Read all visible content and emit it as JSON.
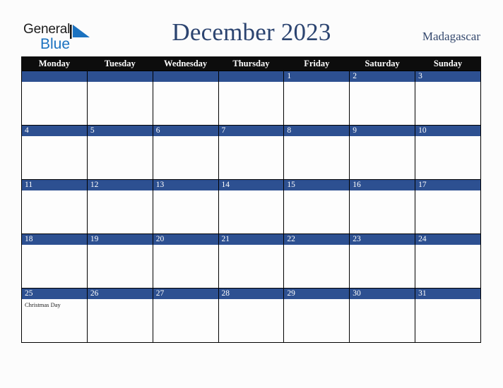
{
  "brand": {
    "name_part1": "General",
    "name_part2": "Blue",
    "triangle_color": "#1b72c0",
    "part1_color": "#1c1c1c",
    "part2_color": "#1b72c0"
  },
  "header": {
    "title": "December 2023",
    "country": "Madagascar",
    "title_color": "#2c4470",
    "country_color": "#35496e"
  },
  "colors": {
    "page_background": "#fcfcfc",
    "weekday_header_background": "#0d0d0d",
    "weekday_header_text": "#ffffff",
    "date_band_background": "#2d5091",
    "date_band_text": "#ffffff",
    "cell_background": "#fdfdfd",
    "cell_border": "#000000",
    "event_text": "#1a1a1a"
  },
  "calendar": {
    "month": "December",
    "year": "2023",
    "weekday_headers": [
      "Monday",
      "Tuesday",
      "Wednesday",
      "Thursday",
      "Friday",
      "Saturday",
      "Sunday"
    ],
    "weeks": [
      [
        {
          "date": "",
          "events": []
        },
        {
          "date": "",
          "events": []
        },
        {
          "date": "",
          "events": []
        },
        {
          "date": "",
          "events": []
        },
        {
          "date": "1",
          "events": []
        },
        {
          "date": "2",
          "events": []
        },
        {
          "date": "3",
          "events": []
        }
      ],
      [
        {
          "date": "4",
          "events": []
        },
        {
          "date": "5",
          "events": []
        },
        {
          "date": "6",
          "events": []
        },
        {
          "date": "7",
          "events": []
        },
        {
          "date": "8",
          "events": []
        },
        {
          "date": "9",
          "events": []
        },
        {
          "date": "10",
          "events": []
        }
      ],
      [
        {
          "date": "11",
          "events": []
        },
        {
          "date": "12",
          "events": []
        },
        {
          "date": "13",
          "events": []
        },
        {
          "date": "14",
          "events": []
        },
        {
          "date": "15",
          "events": []
        },
        {
          "date": "16",
          "events": []
        },
        {
          "date": "17",
          "events": []
        }
      ],
      [
        {
          "date": "18",
          "events": []
        },
        {
          "date": "19",
          "events": []
        },
        {
          "date": "20",
          "events": []
        },
        {
          "date": "21",
          "events": []
        },
        {
          "date": "22",
          "events": []
        },
        {
          "date": "23",
          "events": []
        },
        {
          "date": "24",
          "events": []
        }
      ],
      [
        {
          "date": "25",
          "events": [
            "Christmas Day"
          ]
        },
        {
          "date": "26",
          "events": []
        },
        {
          "date": "27",
          "events": []
        },
        {
          "date": "28",
          "events": []
        },
        {
          "date": "29",
          "events": []
        },
        {
          "date": "30",
          "events": []
        },
        {
          "date": "31",
          "events": []
        }
      ]
    ]
  }
}
